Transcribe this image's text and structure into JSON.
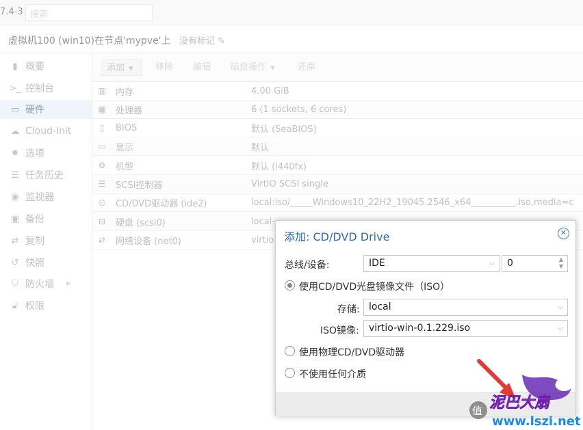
{
  "header": {
    "version": "7.4-3",
    "search_placeholder": "搜索"
  },
  "vm": {
    "title": "虚拟机100 (win10)在节点'mypve'上",
    "no_tags": "没有标记"
  },
  "sidebar": {
    "items": [
      {
        "label": "概要",
        "icon": "book-icon"
      },
      {
        "label": "控制台",
        "icon": "terminal-icon"
      },
      {
        "label": "硬件",
        "icon": "monitor-icon"
      },
      {
        "label": "Cloud-Init",
        "icon": "cloud-icon"
      },
      {
        "label": "选项",
        "icon": "gear-icon"
      },
      {
        "label": "任务历史",
        "icon": "list-icon"
      },
      {
        "label": "监视器",
        "icon": "eye-icon"
      },
      {
        "label": "备份",
        "icon": "floppy-icon"
      },
      {
        "label": "复制",
        "icon": "retweet-icon"
      },
      {
        "label": "快照",
        "icon": "history-icon"
      },
      {
        "label": "防火墙",
        "icon": "shield-icon"
      },
      {
        "label": "权限",
        "icon": "unlock-icon"
      }
    ]
  },
  "toolbar": {
    "add": "添加",
    "remove": "移除",
    "edit": "编辑",
    "disk_action": "磁盘操作",
    "revert": "还原"
  },
  "hardware": [
    {
      "icon": "memory-icon",
      "name": "内存",
      "value": "4.00 GiB"
    },
    {
      "icon": "cpu-icon",
      "name": "处理器",
      "value": "6 (1 sockets, 6 cores)"
    },
    {
      "icon": "microchip-icon",
      "name": "BIOS",
      "value": "默认 (SeaBIOS)"
    },
    {
      "icon": "desktop-icon",
      "name": "显示",
      "value": "默认"
    },
    {
      "icon": "cogs-icon",
      "name": "机型",
      "value": "默认 (i440fx)"
    },
    {
      "icon": "database-icon",
      "name": "SCSI控制器",
      "value": "VirtIO SCSI single"
    },
    {
      "icon": "cdrom-icon",
      "name": "CD/DVD驱动器 (ide2)",
      "value": "local:iso/_____Windows10_22H2_19045.2546_x64__________.iso,media=c"
    },
    {
      "icon": "hdd-icon",
      "name": "硬盘 (scsi0)",
      "value": "local-"
    },
    {
      "icon": "exchange-icon",
      "name": "网络设备 (net0)",
      "value": "virtio="
    }
  ],
  "dialog": {
    "title": "添加: CD/DVD Drive",
    "bus_label": "总线/设备:",
    "bus_value": "IDE",
    "device_value": "0",
    "opt_iso": "使用CD/DVD光盘镜像文件（ISO）",
    "storage_label": "存储:",
    "storage_value": "local",
    "iso_label": "ISO镜像:",
    "iso_value": "virtio-win-0.1.229.iso",
    "opt_physical": "使用物理CD/DVD驱动器",
    "opt_none": "不使用任何介质"
  },
  "watermark": {
    "glyph": "值",
    "brand": "泥巴大扇",
    "url": "www.lszi.net"
  }
}
